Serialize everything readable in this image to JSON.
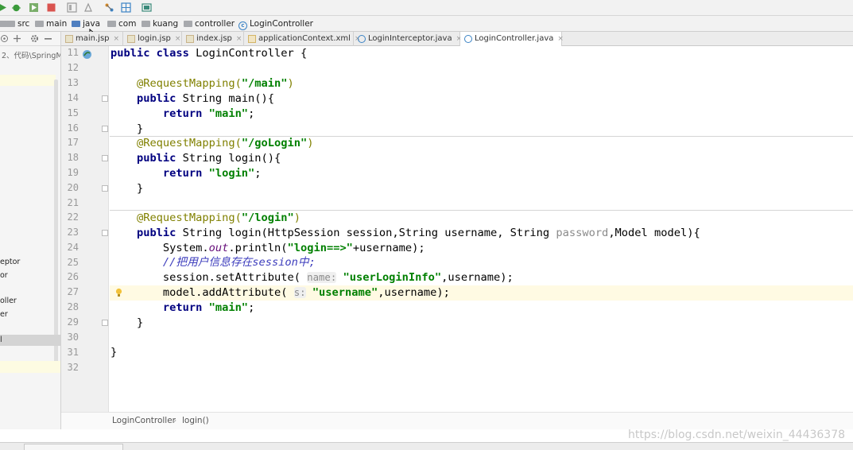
{
  "breadcrumb": {
    "items": [
      "src",
      "main",
      "java",
      "com",
      "kuang",
      "controller",
      "LoginController"
    ]
  },
  "sidebar": {
    "path": "2、代码\\SpringM",
    "rows": [
      "eptor",
      "or",
      "oller",
      "er",
      "l"
    ]
  },
  "tabs": [
    {
      "label": "main.jsp",
      "icon": "jsp-file-icon",
      "active": false
    },
    {
      "label": "login.jsp",
      "icon": "jsp-file-icon",
      "active": false
    },
    {
      "label": "index.jsp",
      "icon": "jsp-file-icon",
      "active": false
    },
    {
      "label": "applicationContext.xml",
      "icon": "xml-file-icon",
      "active": false
    },
    {
      "label": "LoginInterceptor.java",
      "icon": "java-class-icon",
      "active": false
    },
    {
      "label": "LoginController.java",
      "icon": "java-class-icon",
      "active": true
    }
  ],
  "tab_close": "×",
  "editor": {
    "line_numbers": [
      "11",
      "12",
      "13",
      "14",
      "15",
      "16",
      "17",
      "18",
      "19",
      "20",
      "21",
      "22",
      "23",
      "24",
      "25",
      "26",
      "27",
      "28",
      "29",
      "30",
      "31",
      "32"
    ],
    "lines": {
      "l11_a": "public class ",
      "l11_b": "LoginController {",
      "l13_a": "    @RequestMapping(",
      "l13_b": "\"/main\"",
      "l13_c": ")",
      "l14_a": "    public ",
      "l14_b": "String main(){",
      "l15_a": "        return ",
      "l15_b": "\"main\"",
      "l15_c": ";",
      "l16": "    }",
      "l17_a": "    @RequestMapping(",
      "l17_b": "\"/goLogin\"",
      "l17_c": ")",
      "l18_a": "    public ",
      "l18_b": "String login(){",
      "l19_a": "        return ",
      "l19_b": "\"login\"",
      "l19_c": ";",
      "l20": "    }",
      "l22_a": "    @RequestMapping(",
      "l22_b": "\"/login\"",
      "l22_c": ")",
      "l23_a": "    public ",
      "l23_b": "String login(HttpSession session,String username, String ",
      "l23_c": "password",
      "l23_d": ",Model model){",
      "l24_a": "        System.",
      "l24_b": "out",
      "l24_c": ".println(",
      "l24_d": "\"login==>\"",
      "l24_e": "+username);",
      "l25": "        //把用户信息存在session中;",
      "l26_a": "        session.setAttribute( ",
      "l26_hint": "name:",
      "l26_b": " ",
      "l26_c": "\"userLoginInfo\"",
      "l26_d": ",username);",
      "l27_a": "        model.addAttribute( ",
      "l27_hint": "s:",
      "l27_b": " ",
      "l27_c": "\"username\"",
      "l27_d": ",username);",
      "l28_a": "        return ",
      "l28_b": "\"main\"",
      "l28_c": ";",
      "l29": "    }",
      "l31": "}"
    }
  },
  "editor_breadcrumb": {
    "cls": "LoginController",
    "method": "login()"
  },
  "watermark": "https://blog.csdn.net/weixin_44436378",
  "colors": {
    "keyword": "#000080",
    "string": "#008000",
    "annotation": "#808000",
    "comment": "#3d3dbd",
    "current_line": "#fffae3"
  }
}
